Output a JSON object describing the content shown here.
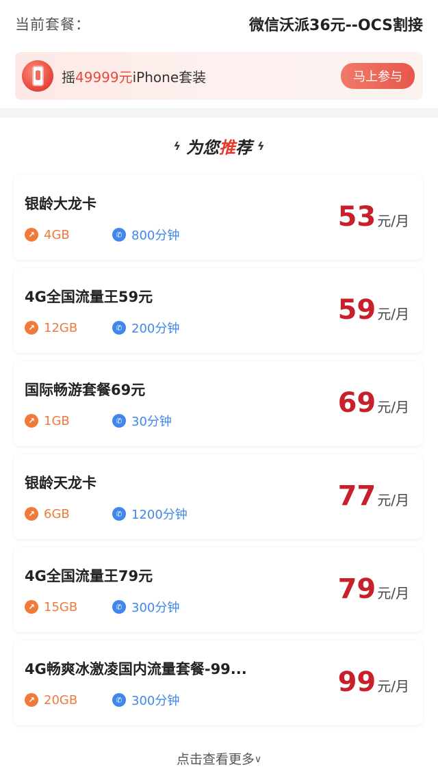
{
  "current": {
    "label": "当前套餐：",
    "value": "微信沃派36元--OCS割接"
  },
  "promo": {
    "text_prefix": "摇",
    "text_highlight": "49999元",
    "text_suffix": "iPhone套装",
    "button_label": "马上参与"
  },
  "recommend": {
    "title_part1": "为您",
    "title_emph": "推",
    "title_part2": "荐",
    "plans": [
      {
        "name": "银龄大龙卡",
        "data": "4GB",
        "minutes": "800分钟",
        "price": "53",
        "unit": "元/月"
      },
      {
        "name": "4G全国流量王59元",
        "data": "12GB",
        "minutes": "200分钟",
        "price": "59",
        "unit": "元/月"
      },
      {
        "name": "国际畅游套餐69元",
        "data": "1GB",
        "minutes": "30分钟",
        "price": "69",
        "unit": "元/月"
      },
      {
        "name": "银龄天龙卡",
        "data": "6GB",
        "minutes": "1200分钟",
        "price": "77",
        "unit": "元/月"
      },
      {
        "name": "4G全国流量王79元",
        "data": "15GB",
        "minutes": "300分钟",
        "price": "79",
        "unit": "元/月"
      },
      {
        "name": "4G畅爽冰激凌国内流量套餐-99...",
        "data": "20GB",
        "minutes": "300分钟",
        "price": "99",
        "unit": "元/月"
      }
    ],
    "more_label": "点击查看更多"
  },
  "colors": {
    "accent_red": "#c8202b",
    "data_orange": "#ef7a3a",
    "call_blue": "#3f87ea"
  }
}
